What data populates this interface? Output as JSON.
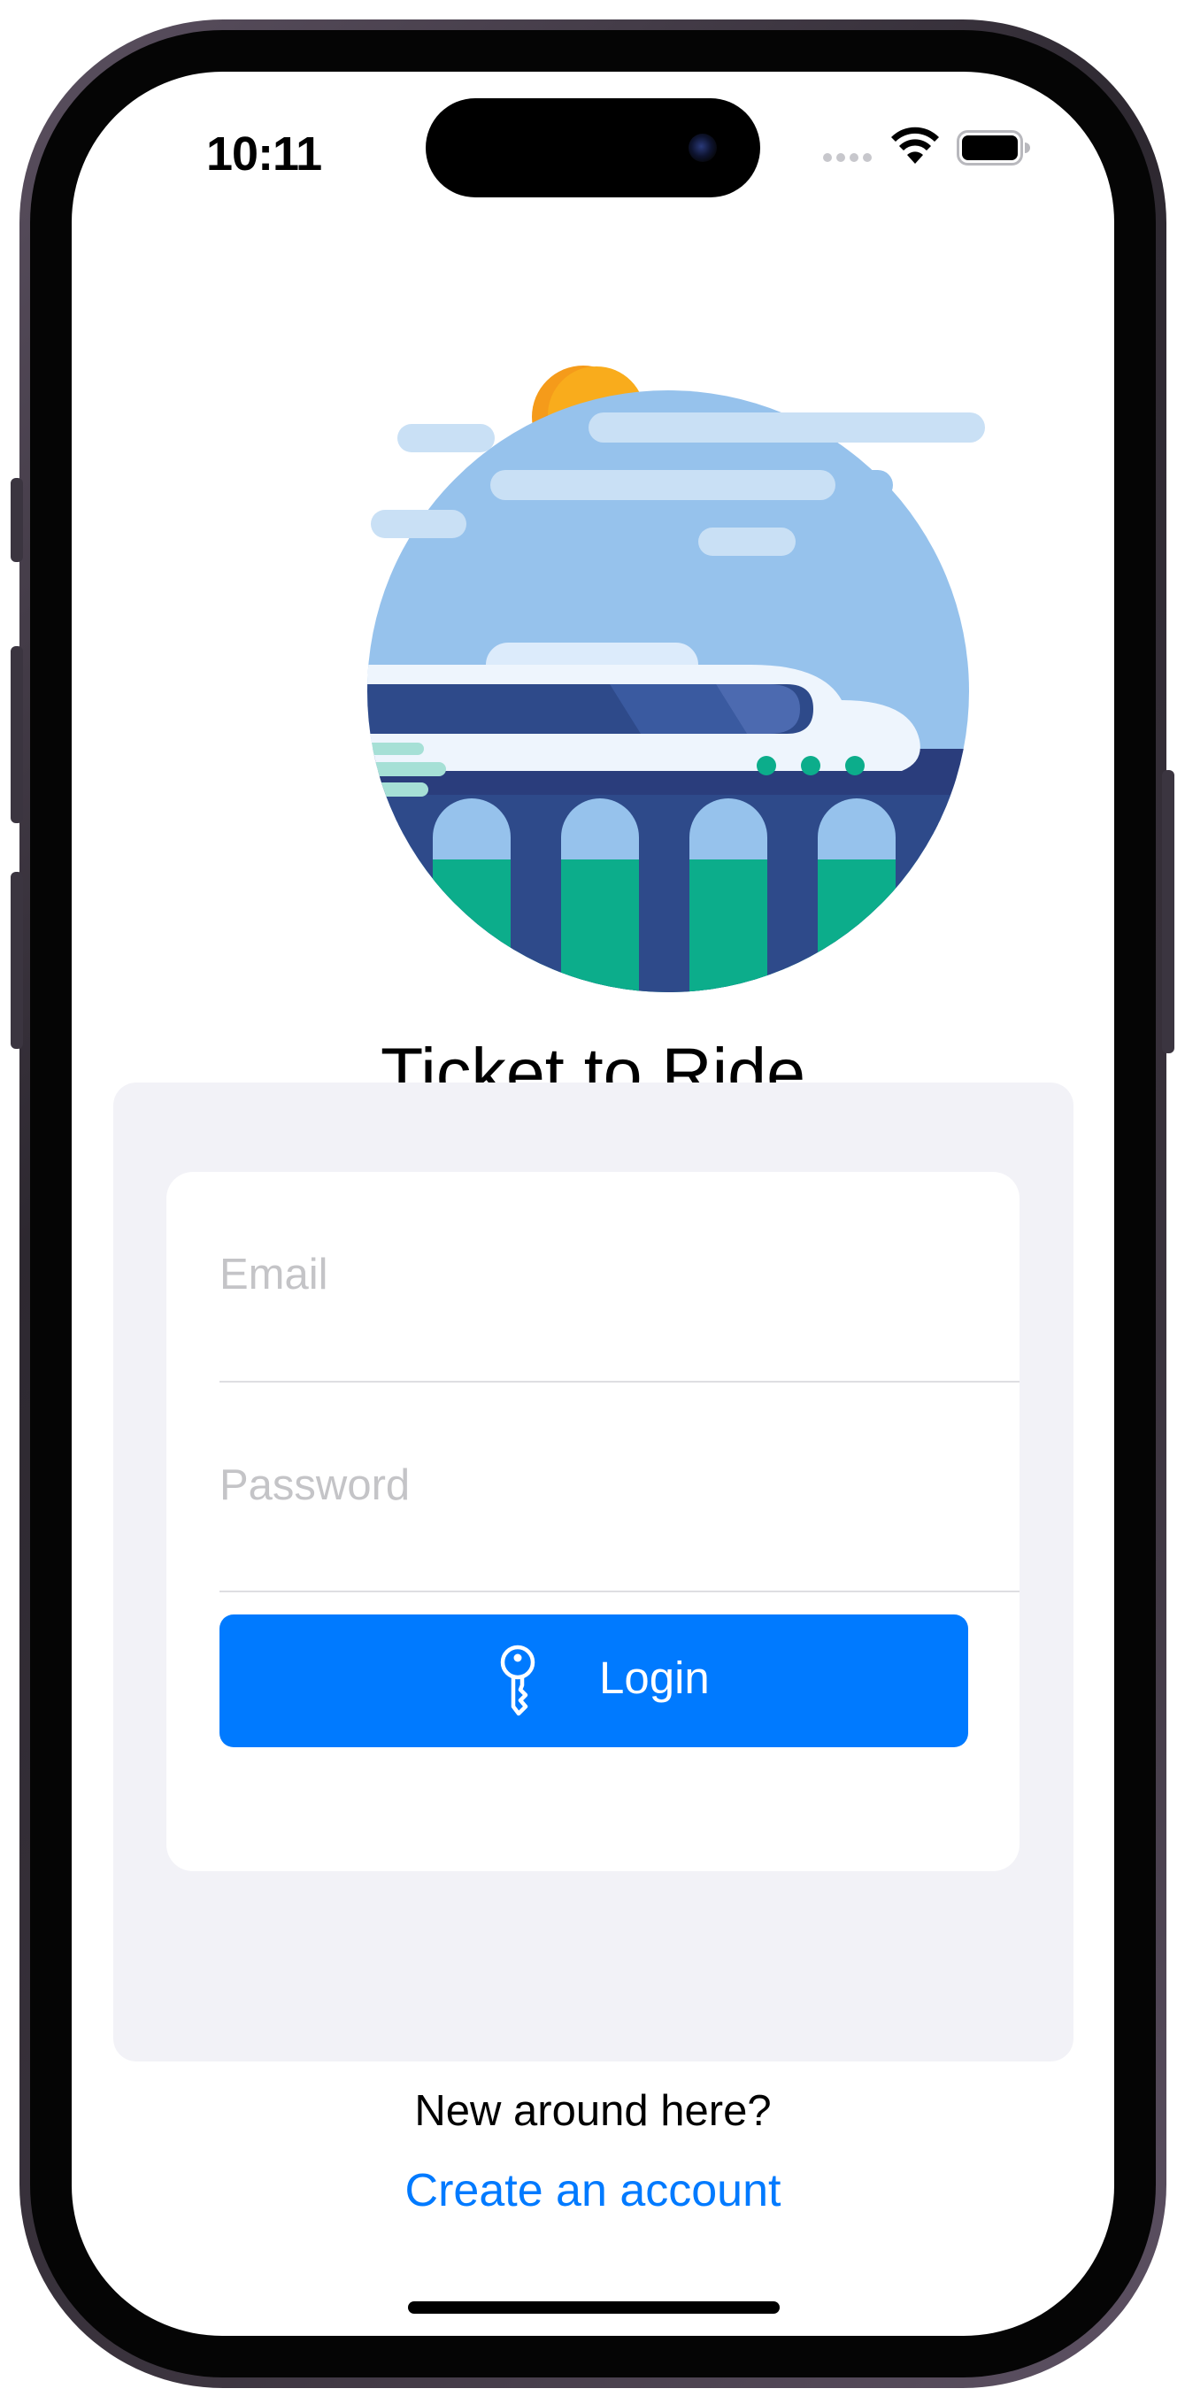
{
  "status_bar": {
    "time": "10:11"
  },
  "app": {
    "title": "Ticket to Ride",
    "illustration": "train-on-viaduct-illustration"
  },
  "login_form": {
    "email_placeholder": "Email",
    "password_placeholder": "Password",
    "login_label": "Login",
    "login_icon": "key-icon"
  },
  "signup": {
    "prompt": "New around here?",
    "link_label": "Create an account"
  },
  "colors": {
    "accent": "#007aff",
    "panel_background": "#f2f2f7",
    "sky": "#96c2ec",
    "train_body": "#eef5fd",
    "bridge": "#2e4a8a",
    "water": "#0cad8b",
    "sun": "#f9ac1c"
  }
}
